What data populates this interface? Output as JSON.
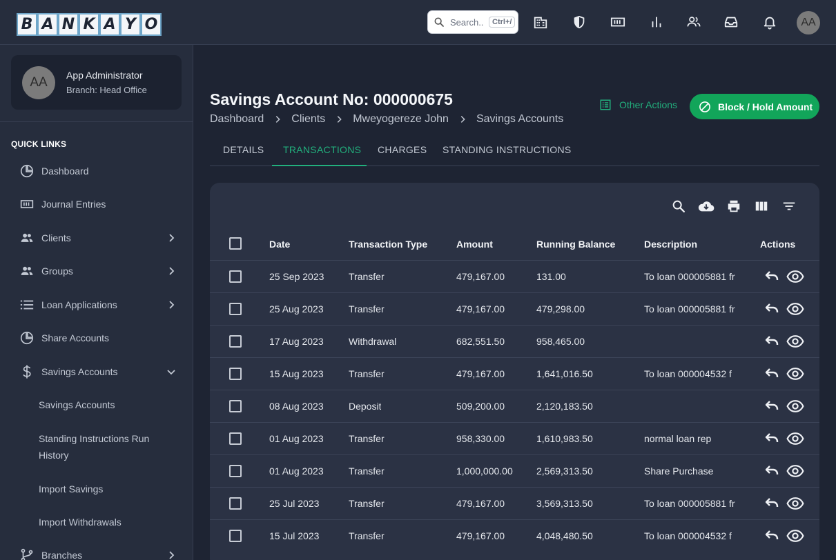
{
  "header": {
    "logo_letters": [
      "B",
      "A",
      "N",
      "K",
      "A",
      "Y",
      "O"
    ],
    "search": {
      "placeholder": "Search..",
      "shortcut": "Ctrl+/"
    },
    "icons": [
      "office-building-icon",
      "shield-icon",
      "cash-register-icon",
      "bar-chart-icon",
      "users-icon",
      "inbox-icon",
      "bell-icon"
    ],
    "avatar_initials": "AA"
  },
  "sidebar": {
    "user": {
      "initials": "AA",
      "name": "App Administrator",
      "branch": "Branch: Head Office"
    },
    "section_title": "QUICK LINKS",
    "items": [
      {
        "label": "Dashboard",
        "icon": "pie-chart-icon",
        "has_chevron": false
      },
      {
        "label": "Journal Entries",
        "icon": "cash-icon",
        "has_chevron": false
      },
      {
        "label": "Clients",
        "icon": "users-icon",
        "has_chevron": true
      },
      {
        "label": "Groups",
        "icon": "users-icon",
        "has_chevron": true
      },
      {
        "label": "Loan Applications",
        "icon": "list-icon",
        "has_chevron": true
      },
      {
        "label": "Share Accounts",
        "icon": "pie-chart-icon",
        "has_chevron": false
      },
      {
        "label": "Savings Accounts",
        "icon": "dollar-icon",
        "has_chevron": true,
        "expanded": true
      },
      {
        "label": "Branches",
        "icon": "branch-icon",
        "has_chevron": true
      }
    ],
    "subitems": [
      "Savings Accounts",
      "Standing Instructions Run History",
      "Import Savings",
      "Import Withdrawals"
    ]
  },
  "page": {
    "title": "Savings Account No: 000000675",
    "breadcrumbs": [
      "Dashboard",
      "Clients",
      "Mweyogereze John",
      "Savings Accounts"
    ],
    "other_actions_label": "Other Actions",
    "block_button_label": "Block / Hold Amount",
    "tabs": [
      {
        "label": "DETAILS",
        "active": false
      },
      {
        "label": "TRANSACTIONS",
        "active": true
      },
      {
        "label": "CHARGES",
        "active": false
      },
      {
        "label": "STANDING INSTRUCTIONS",
        "active": false
      }
    ]
  },
  "table": {
    "toolbar_icons": [
      "search-icon",
      "cloud-download-icon",
      "print-icon",
      "columns-icon",
      "filter-icon"
    ],
    "columns": [
      "Date",
      "Transaction Type",
      "Amount",
      "Running Balance",
      "Description",
      "Actions"
    ],
    "rows": [
      {
        "date": "25 Sep 2023",
        "type": "Transfer",
        "amount": "479,167.00",
        "balance": "131.00",
        "description": "To loan 000005881 fr"
      },
      {
        "date": "25 Aug 2023",
        "type": "Transfer",
        "amount": "479,167.00",
        "balance": "479,298.00",
        "description": "To loan 000005881 fr"
      },
      {
        "date": "17 Aug 2023",
        "type": "Withdrawal",
        "amount": "682,551.50",
        "balance": "958,465.00",
        "description": ""
      },
      {
        "date": "15 Aug 2023",
        "type": "Transfer",
        "amount": "479,167.00",
        "balance": "1,641,016.50",
        "description": "To loan 000004532 f"
      },
      {
        "date": "08 Aug 2023",
        "type": "Deposit",
        "amount": "509,200.00",
        "balance": "2,120,183.50",
        "description": ""
      },
      {
        "date": "01 Aug 2023",
        "type": "Transfer",
        "amount": "958,330.00",
        "balance": "1,610,983.50",
        "description": "normal loan rep"
      },
      {
        "date": "01 Aug 2023",
        "type": "Transfer",
        "amount": "1,000,000.00",
        "balance": "2,569,313.50",
        "description": "Share Purchase"
      },
      {
        "date": "25 Jul 2023",
        "type": "Transfer",
        "amount": "479,167.00",
        "balance": "3,569,313.50",
        "description": "To loan 000005881 fr"
      },
      {
        "date": "15 Jul 2023",
        "type": "Transfer",
        "amount": "479,167.00",
        "balance": "4,048,480.50",
        "description": "To loan 000004532 f"
      }
    ]
  },
  "colors": {
    "accent": "#22b07d",
    "button_green": "#12a55a",
    "background": "#1e2433",
    "sidebar": "#262d3d",
    "panel": "#2b3244"
  }
}
